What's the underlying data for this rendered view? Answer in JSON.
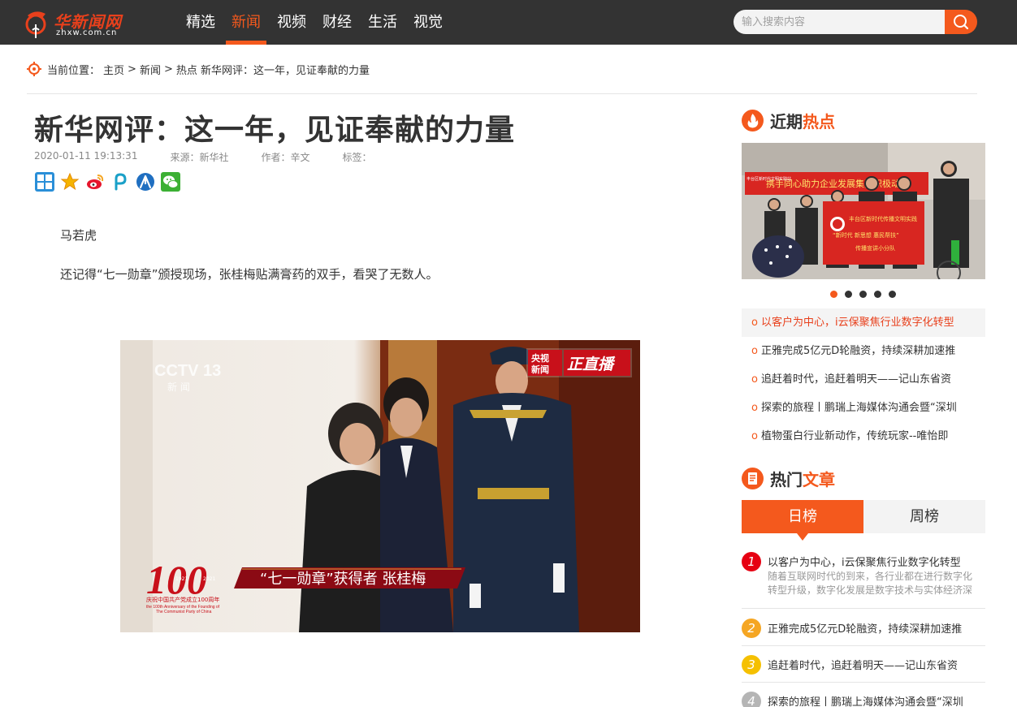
{
  "header": {
    "logo_title": "华新闻网",
    "logo_domain": "zhxw.com.cn",
    "nav": [
      "精选",
      "新闻",
      "视频",
      "财经",
      "生活",
      "视觉"
    ],
    "active_nav": "新闻",
    "search_placeholder": "输入搜索内容"
  },
  "breadcrumb": {
    "label": "当前位置：",
    "home": "主页",
    "sep": ">",
    "section": "新闻",
    "current": "热点 新华网评：这一年，见证奉献的力量"
  },
  "article": {
    "title": "新华网评：这一年，见证奉献的力量",
    "date": "2020-01-11 19:13:31",
    "source": "来源：新华社",
    "author": "作者：辛文",
    "tags_label": "标签：",
    "author_line": "马若虎",
    "para1": "还记得“七一勋章”颁授现场，张桂梅贴满膏药的双手，看哭了无数人。",
    "image": {
      "tv_logo": "CCTV 13",
      "tv_sub": "新 闻",
      "live_badge_top": "央视",
      "live_badge_bottom": "新闻",
      "live_text": "正直播",
      "caption": "“七一勋章”获得者 张桂梅",
      "anniv_number": "100",
      "anniv_cn": "庆祝中国共产党成立100周年",
      "anniv_en1": "the 100th Anniversary of the Founding of",
      "anniv_en2": "The Communist Party of China",
      "anniv_y1": "1921",
      "anniv_y2": "2021"
    }
  },
  "share_icons": [
    "plus-share-icon",
    "qzone-icon",
    "weibo-icon",
    "pengyou-icon",
    "renren-icon",
    "wechat-icon"
  ],
  "sidebar": {
    "hot": {
      "title_a": "近期",
      "title_b": "热点",
      "banner_text": "携手同心助力企业发展集团积极动员",
      "banner_text2": "丰台区新时代文明实践站",
      "sign_line1": "丰台区新时代传播文明实践",
      "sign_line2": "“新时代 新思想 惠民帮扶”",
      "sign_line3": "传播宣讲小分队",
      "carousel_count": 5,
      "carousel_active": 1,
      "items": [
        "以客户为中心，i云保聚焦行业数字化转型",
        "正雅完成5亿元D轮融资，持续深耕加速推",
        "追赶着时代，追赶着明天——记山东省资",
        "探索的旅程丨鹏瑞上海媒体沟通会暨“深圳",
        "植物蛋白行业新动作，传统玩家--唯怡即"
      ]
    },
    "popular": {
      "title_a": "热门",
      "title_b": "文章",
      "tab_day": "日榜",
      "tab_week": "周榜",
      "items": [
        {
          "num": "1",
          "title": "以客户为中心，i云保聚焦行业数字化转型",
          "desc": "随着互联网时代的到来，各行业都在进行数字化转型升级，数字化发展是数字技术与实体经济深"
        },
        {
          "num": "2",
          "title": "正雅完成5亿元D轮融资，持续深耕加速推"
        },
        {
          "num": "3",
          "title": "追赶着时代，追赶着明天——记山东省资"
        },
        {
          "num": "4",
          "title": "探索的旅程丨鹏瑞上海媒体沟通会暨“深圳"
        }
      ],
      "colors": [
        "#e60012",
        "#f5a623",
        "#f5c000",
        "#b5b5b5"
      ]
    }
  },
  "colors": {
    "accent": "#f4591d",
    "topbar": "#333333"
  }
}
